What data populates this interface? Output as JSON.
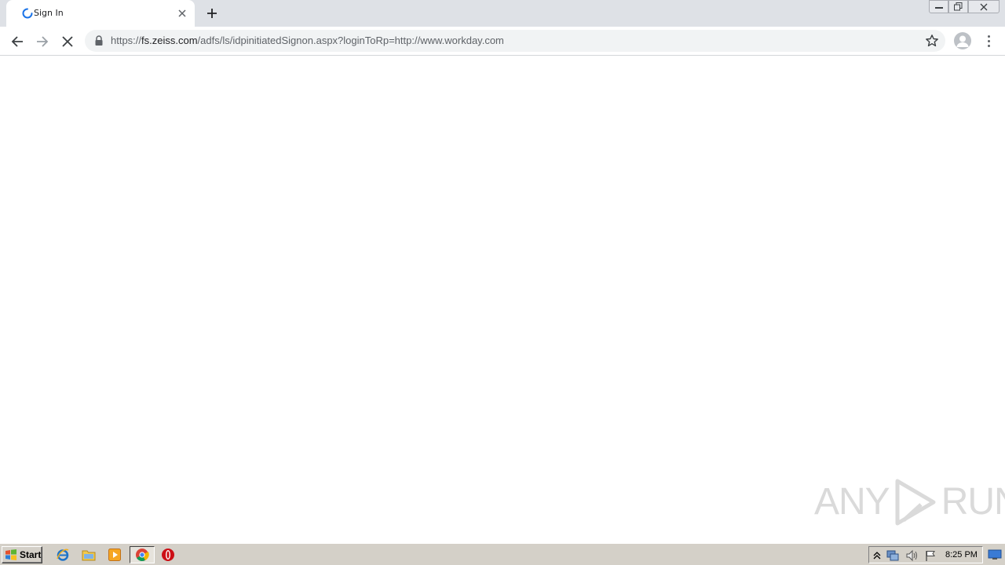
{
  "browser": {
    "tab": {
      "title": "Sign In",
      "loading": true
    },
    "address_bar": {
      "scheme": "https://",
      "host": "fs.zeiss.com",
      "path": "/adfs/ls/idpinitiatedSignon.aspx?loginToRp=http://www.workday.com"
    },
    "icons": {
      "back": "back-arrow-icon",
      "forward": "forward-arrow-icon",
      "stop": "stop-loading-icon",
      "lock": "lock-icon",
      "bookmark": "star-icon",
      "profile": "avatar-icon",
      "menu": "kebab-menu-icon"
    }
  },
  "watermark": {
    "text_left": "ANY",
    "text_right": "RUN"
  },
  "taskbar": {
    "start_label": "Start",
    "clock": "8:25 PM",
    "pinned": [
      "internet-explorer-icon",
      "file-explorer-icon",
      "media-player-icon",
      "chrome-icon",
      "opera-icon"
    ]
  },
  "colors": {
    "tabstrip": "#dee1e6",
    "omnibox": "#f1f3f4",
    "taskbar": "#d4d0c8",
    "spinner": "#1a73e8"
  }
}
